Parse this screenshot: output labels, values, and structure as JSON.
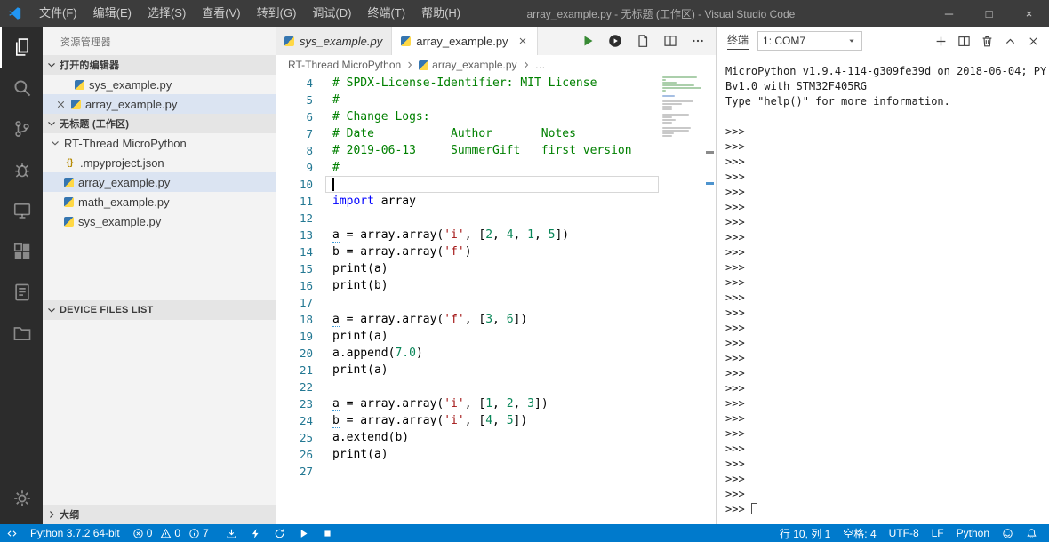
{
  "title_bar": {
    "title": "array_example.py - 无标题 (工作区) - Visual Studio Code",
    "menus": [
      {
        "id": "file",
        "label": "文件(F)"
      },
      {
        "id": "edit",
        "label": "编辑(E)"
      },
      {
        "id": "selection",
        "label": "选择(S)"
      },
      {
        "id": "view",
        "label": "查看(V)"
      },
      {
        "id": "go",
        "label": "转到(G)"
      },
      {
        "id": "debug",
        "label": "调试(D)"
      },
      {
        "id": "terminal",
        "label": "终端(T)"
      },
      {
        "id": "help",
        "label": "帮助(H)"
      }
    ],
    "window_controls": [
      {
        "name": "minimize",
        "glyph": "─"
      },
      {
        "name": "maximize",
        "glyph": "□"
      },
      {
        "name": "close",
        "glyph": "×"
      }
    ]
  },
  "activity_bar": {
    "top": [
      {
        "name": "explorer",
        "icon": "files",
        "active": true
      },
      {
        "name": "search",
        "icon": "search"
      },
      {
        "name": "source-control",
        "icon": "git"
      },
      {
        "name": "debug",
        "icon": "bug"
      },
      {
        "name": "remote-device",
        "icon": "monitor"
      },
      {
        "name": "extensions",
        "icon": "extensions"
      },
      {
        "name": "project-notes",
        "icon": "document"
      },
      {
        "name": "file-browser",
        "icon": "folder"
      }
    ],
    "bottom": [
      {
        "name": "settings",
        "icon": "gear"
      }
    ]
  },
  "sidebar": {
    "title": "资源管理器",
    "open_editors": {
      "label": "打开的编辑器",
      "items": [
        {
          "label": "sys_example.py",
          "icon": "python"
        },
        {
          "label": "array_example.py",
          "icon": "python",
          "selected": true,
          "closable": true
        }
      ]
    },
    "workspace": {
      "label": "无标题 (工作区)",
      "tree": [
        {
          "label": "RT-Thread MicroPython",
          "type": "folder",
          "level": 0,
          "expanded": true
        },
        {
          "label": ".mpyproject.json",
          "icon": "json",
          "level": 1
        },
        {
          "label": "array_example.py",
          "icon": "python",
          "level": 1,
          "selected": true
        },
        {
          "label": "math_example.py",
          "icon": "python",
          "level": 1
        },
        {
          "label": "sys_example.py",
          "icon": "python",
          "level": 1
        }
      ]
    },
    "device_files": {
      "label": "DEVICE FILES LIST"
    },
    "outline": {
      "label": "大纲"
    }
  },
  "editor": {
    "tabs": [
      {
        "label": "sys_example.py",
        "icon": "python",
        "preview": true
      },
      {
        "label": "array_example.py",
        "icon": "python",
        "active": true,
        "closable": true
      }
    ],
    "actions": [
      {
        "name": "run-python-file",
        "icon": "play"
      },
      {
        "name": "run-on-device",
        "icon": "circle-run"
      },
      {
        "name": "open-document",
        "icon": "file"
      },
      {
        "name": "split-editor",
        "icon": "split"
      },
      {
        "name": "more-actions",
        "icon": "more"
      }
    ],
    "breadcrumb": [
      {
        "label": "RT-Thread MicroPython"
      },
      {
        "label": "array_example.py",
        "icon": "python"
      },
      {
        "label": "…"
      }
    ],
    "code": {
      "lines": [
        {
          "n": 4,
          "t": [
            [
              "c",
              "# SPDX-License-Identifier: MIT License"
            ]
          ]
        },
        {
          "n": 5,
          "t": [
            [
              "c",
              "#"
            ]
          ]
        },
        {
          "n": 6,
          "t": [
            [
              "c",
              "# Change Logs:"
            ]
          ]
        },
        {
          "n": 7,
          "t": [
            [
              "c",
              "# Date           Author       Notes"
            ]
          ]
        },
        {
          "n": 8,
          "t": [
            [
              "c",
              "# 2019-06-13     SummerGift   first version"
            ]
          ]
        },
        {
          "n": 9,
          "t": [
            [
              "c",
              "#"
            ]
          ]
        },
        {
          "n": 10,
          "t": [],
          "current": true
        },
        {
          "n": 11,
          "t": [
            [
              "k",
              "import"
            ],
            [
              "p",
              " array"
            ]
          ]
        },
        {
          "n": 12,
          "t": []
        },
        {
          "n": 13,
          "t": [
            [
              "u",
              "a"
            ],
            [
              "p",
              " = array.array("
            ],
            [
              "s",
              "'i'"
            ],
            [
              "p",
              ", ["
            ],
            [
              "n",
              "2"
            ],
            [
              "p",
              ", "
            ],
            [
              "n",
              "4"
            ],
            [
              "p",
              ", "
            ],
            [
              "n",
              "1"
            ],
            [
              "p",
              ", "
            ],
            [
              "n",
              "5"
            ],
            [
              "p",
              "])"
            ]
          ]
        },
        {
          "n": 14,
          "t": [
            [
              "u",
              "b"
            ],
            [
              "p",
              " = array.array("
            ],
            [
              "s",
              "'f'"
            ],
            [
              "p",
              ")"
            ]
          ]
        },
        {
          "n": 15,
          "t": [
            [
              "p",
              "print(a)"
            ]
          ]
        },
        {
          "n": 16,
          "t": [
            [
              "p",
              "print(b)"
            ]
          ]
        },
        {
          "n": 17,
          "t": []
        },
        {
          "n": 18,
          "t": [
            [
              "u",
              "a"
            ],
            [
              "p",
              " = array.array("
            ],
            [
              "s",
              "'f'"
            ],
            [
              "p",
              ", ["
            ],
            [
              "n",
              "3"
            ],
            [
              "p",
              ", "
            ],
            [
              "n",
              "6"
            ],
            [
              "p",
              "])"
            ]
          ]
        },
        {
          "n": 19,
          "t": [
            [
              "p",
              "print(a)"
            ]
          ]
        },
        {
          "n": 20,
          "t": [
            [
              "p",
              "a.append("
            ],
            [
              "n",
              "7.0"
            ],
            [
              "p",
              ")"
            ]
          ]
        },
        {
          "n": 21,
          "t": [
            [
              "p",
              "print(a)"
            ]
          ]
        },
        {
          "n": 22,
          "t": []
        },
        {
          "n": 23,
          "t": [
            [
              "u",
              "a"
            ],
            [
              "p",
              " = array.array("
            ],
            [
              "s",
              "'i'"
            ],
            [
              "p",
              ", ["
            ],
            [
              "n",
              "1"
            ],
            [
              "p",
              ", "
            ],
            [
              "n",
              "2"
            ],
            [
              "p",
              ", "
            ],
            [
              "n",
              "3"
            ],
            [
              "p",
              "])"
            ]
          ]
        },
        {
          "n": 24,
          "t": [
            [
              "u",
              "b"
            ],
            [
              "p",
              " = array.array("
            ],
            [
              "s",
              "'i'"
            ],
            [
              "p",
              ", ["
            ],
            [
              "n",
              "4"
            ],
            [
              "p",
              ", "
            ],
            [
              "n",
              "5"
            ],
            [
              "p",
              "])"
            ]
          ]
        },
        {
          "n": 25,
          "t": [
            [
              "p",
              "a.extend(b)"
            ]
          ]
        },
        {
          "n": 26,
          "t": [
            [
              "p",
              "print(a)"
            ]
          ]
        },
        {
          "n": 27,
          "t": []
        }
      ]
    }
  },
  "terminal": {
    "title": "终端",
    "dropdown_value": "1: COM7",
    "actions": [
      {
        "name": "new-terminal",
        "icon": "plus"
      },
      {
        "name": "split-terminal",
        "icon": "split"
      },
      {
        "name": "kill-terminal",
        "icon": "trash"
      },
      {
        "name": "maximize-panel",
        "icon": "chevron-up"
      },
      {
        "name": "close-panel",
        "icon": "close"
      }
    ],
    "banner": [
      "MicroPython v1.9.4-114-g309fe39d on 2018-06-04; PY",
      "Bv1.0 with STM32F405RG",
      "Type \"help()\" for more information."
    ],
    "prompt": ">>>",
    "prompt_lines": 25
  },
  "status_bar": {
    "left": [
      {
        "name": "remote",
        "icon": "remote"
      },
      {
        "name": "python-interpreter",
        "label": "Python 3.7.2 64-bit"
      },
      {
        "name": "problems",
        "parts": [
          {
            "icon": "error",
            "count": "0"
          },
          {
            "icon": "warning",
            "count": "0"
          },
          {
            "icon": "info",
            "count": "7"
          }
        ]
      },
      {
        "name": "download-to-device",
        "icon": "download"
      },
      {
        "name": "flash-firmware",
        "icon": "flash"
      },
      {
        "name": "sync-device",
        "icon": "sync"
      },
      {
        "name": "run-program",
        "icon": "run"
      },
      {
        "name": "stop-program",
        "icon": "stop"
      }
    ],
    "right": [
      {
        "name": "cursor-position",
        "label": "行 10, 列 1"
      },
      {
        "name": "indentation",
        "label": "空格: 4"
      },
      {
        "name": "encoding",
        "label": "UTF-8"
      },
      {
        "name": "eol",
        "label": "LF"
      },
      {
        "name": "language-mode",
        "label": "Python"
      },
      {
        "name": "feedback",
        "icon": "smiley"
      },
      {
        "name": "notifications",
        "icon": "bell"
      }
    ]
  },
  "colors": {
    "accent": "#007acc",
    "titlebar": "#3c3c3c",
    "activitybar": "#2c2c2c",
    "sidebar": "#f3f3f3",
    "comment": "#008000",
    "keyword": "#0000ff",
    "string": "#a31515",
    "number": "#098658"
  }
}
